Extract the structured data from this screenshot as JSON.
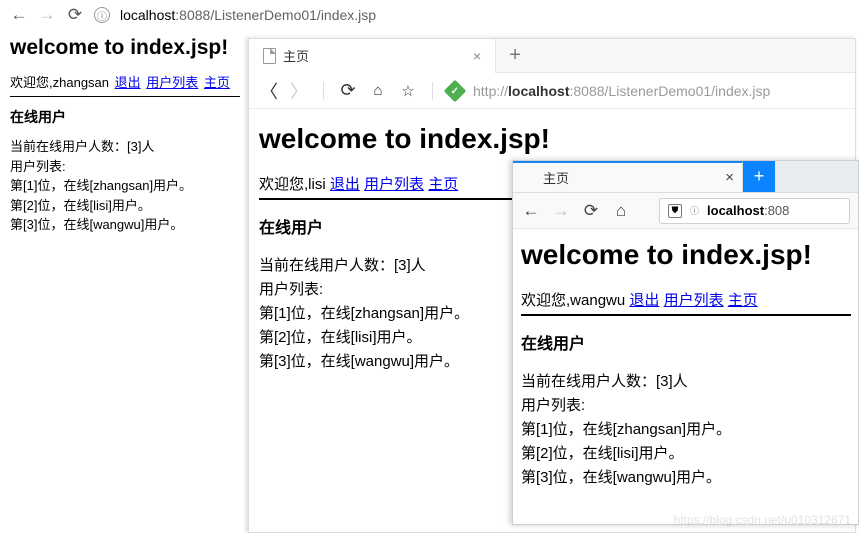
{
  "chrome": {
    "url_info_char": "ⓘ",
    "url_host": "localhost",
    "url_port": ":8088",
    "url_path": "/ListenerDemo01/index.jsp"
  },
  "page1": {
    "title": "welcome to index.jsp!",
    "greet_prefix": "欢迎您,",
    "user": "zhangsan",
    "link_logout": "退出",
    "link_userlist": "用户列表",
    "link_home": "主页",
    "section_heading": "在线用户",
    "count_line": "当前在线用户人数：[3]人",
    "list_header": "用户列表:",
    "row1": "第[1]位，在线[zhangsan]用户。",
    "row2": "第[2]位，在线[lisi]用户。",
    "row3": "第[3]位，在线[wangwu]用户。"
  },
  "win2": {
    "tab_title": "主页",
    "tab_close": "×",
    "tab_add": "+",
    "secure_char": "✓",
    "url_scheme": "http://",
    "url_host": "localhost",
    "url_port": ":8088",
    "url_path": "/ListenerDemo01/index.jsp",
    "title": "welcome to index.jsp!",
    "greet_prefix": "欢迎您,",
    "user": "lisi",
    "link_logout": "退出",
    "link_userlist": "用户列表",
    "link_home": "主页",
    "section_heading": "在线用户",
    "count_line": "当前在线用户人数：[3]人",
    "list_header": "用户列表:",
    "row1": "第[1]位，在线[zhangsan]用户。",
    "row2": "第[2]位，在线[lisi]用户。",
    "row3": "第[3]位，在线[wangwu]用户。"
  },
  "win3": {
    "tab_title": "主页",
    "tab_close": "×",
    "tab_add": "+",
    "shield_char": "⛊",
    "info_char": "ⓘ",
    "url_host": "localhost",
    "url_port": ":808",
    "title": "welcome to index.jsp!",
    "greet_prefix": "欢迎您,",
    "user": "wangwu",
    "link_logout": "退出",
    "link_userlist": "用户列表",
    "link_home": "主页",
    "section_heading": "在线用户",
    "count_line": "当前在线用户人数：[3]人",
    "list_header": "用户列表:",
    "row1": "第[1]位，在线[zhangsan]用户。",
    "row2": "第[2]位，在线[lisi]用户。",
    "row3": "第[3]位，在线[wangwu]用户。"
  },
  "watermark": "https://blog.csdn.net/u010312671"
}
